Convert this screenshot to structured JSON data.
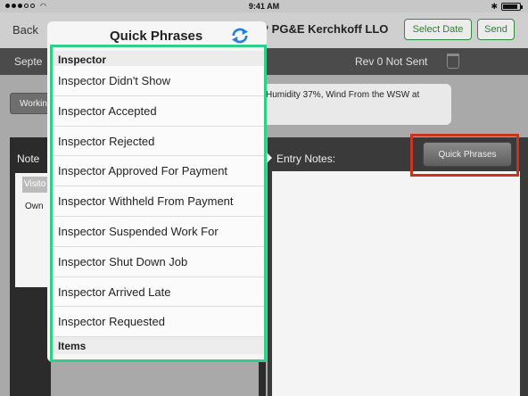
{
  "status_bar": {
    "time": "9:41 AM",
    "wifi_icon": "wifi-icon",
    "bluetooth_icon": "bluetooth-icon",
    "battery_level": 0.9
  },
  "nav": {
    "back_label": "Back",
    "title": "* PG&E Kerchkoff LLO",
    "select_date_label": "Select Date",
    "send_label": "Send",
    "accent_color": "#2e7d32"
  },
  "sub_bar": {
    "date_fragment": "Septe",
    "revision": "Rev 0 Not Sent",
    "trash_icon": "trash-icon"
  },
  "content": {
    "working_button_fragment": "Workin",
    "weather_text": "Humidity 37%, Wind From the WSW at",
    "note_label_fragment": "Note",
    "visitors_fragment": "Visito",
    "owner_fragment": "Own",
    "entry_notes_label": "Entry Notes:",
    "quick_phrases_button": "Quick Phrases",
    "highlight_color": "#c8341e"
  },
  "popover": {
    "title": "Quick Phrases",
    "refresh_icon": "refresh-icon",
    "frame_color": "#2fcf8a",
    "section_header": "Inspector",
    "phrases": [
      "Inspector Didn't Show",
      "Inspector Accepted",
      "Inspector Rejected",
      "Inspector Approved For Payment",
      "Inspector Withheld From Payment",
      "Inspector Suspended Work For",
      "Inspector Shut Down Job",
      "Inspector Arrived Late",
      "Inspector Requested"
    ],
    "next_section_header": "Items"
  }
}
